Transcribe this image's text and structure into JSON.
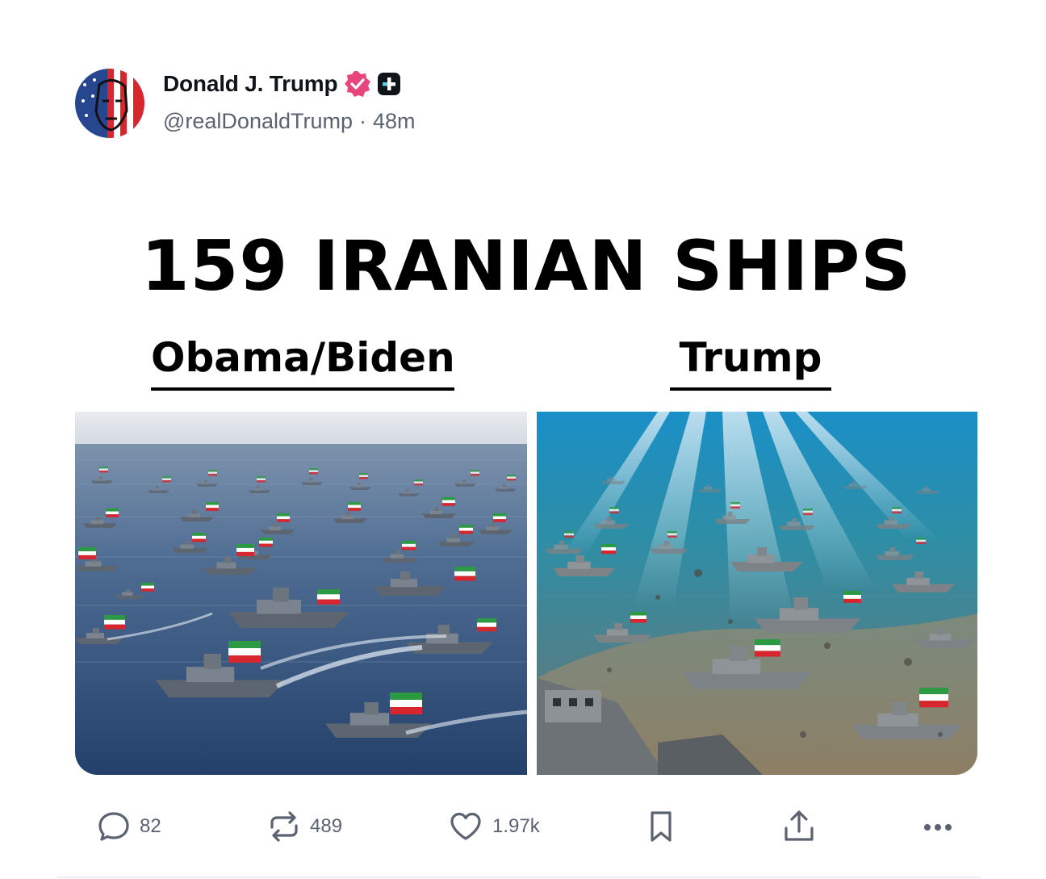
{
  "author": {
    "display_name": "Donald J. Trump",
    "handle": "@realDonaldTrump",
    "separator": "·",
    "time_ago": "48m"
  },
  "media": {
    "headline": "159 IRANIAN SHIPS",
    "left_label": "Obama/Biden",
    "right_label": "Trump"
  },
  "actions": {
    "reply_count": "82",
    "repost_count": "489",
    "like_count": "1.97k"
  },
  "colors": {
    "verified_badge": "#e8457c",
    "secondary_text": "#5b6270",
    "primary_text": "#0f1419"
  },
  "icons": [
    "avatar",
    "verified-icon",
    "platform-badge-icon",
    "reply-icon",
    "repost-icon",
    "like-icon",
    "bookmark-icon",
    "share-icon",
    "more-icon"
  ]
}
